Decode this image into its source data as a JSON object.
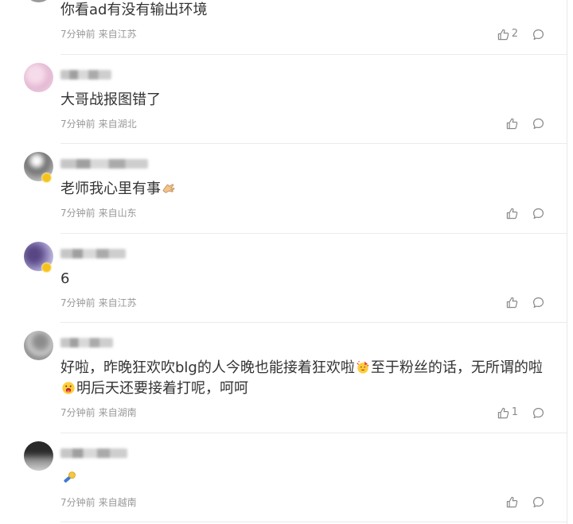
{
  "colors": {
    "background": "#ffffff",
    "text": "#333333",
    "meta": "#999999",
    "icon": "#8a8a8a",
    "divider": "#ebebeb",
    "badge": "#f5c21b"
  },
  "icons": {
    "like": "thumbs-up-icon",
    "reply": "comment-bubble-icon",
    "badge": "vip-badge-icon"
  },
  "comments": [
    {
      "text": "你看ad有没有输出环境",
      "time": "7分钟前",
      "source": "来自江苏",
      "likes": "2"
    },
    {
      "text": "大哥战报图错了",
      "time": "7分钟前",
      "source": "来自湖北"
    },
    {
      "text": "老师我心里有事",
      "emoji": [
        "hand-emoji-icon"
      ],
      "time": "7分钟前",
      "source": "来自山东",
      "verified_badge": true
    },
    {
      "text": "6",
      "time": "7分钟前",
      "source": "来自江苏",
      "verified_badge": true
    },
    {
      "text_segments": [
        "好啦，昨晚狂欢吹blg的人今晚也能接着狂欢啦",
        "至于粉丝的话，无所谓的啦",
        "明后天还要接着打呢，呵呵"
      ],
      "emoji": [
        "party-face-emoji-icon",
        "tongue-out-face-emoji-icon"
      ],
      "time": "7分钟前",
      "source": "来自湖南",
      "likes": "1"
    },
    {
      "emoji": [
        "microphone-emoji-icon"
      ],
      "time": "7分钟前",
      "source": "来自越南"
    }
  ]
}
